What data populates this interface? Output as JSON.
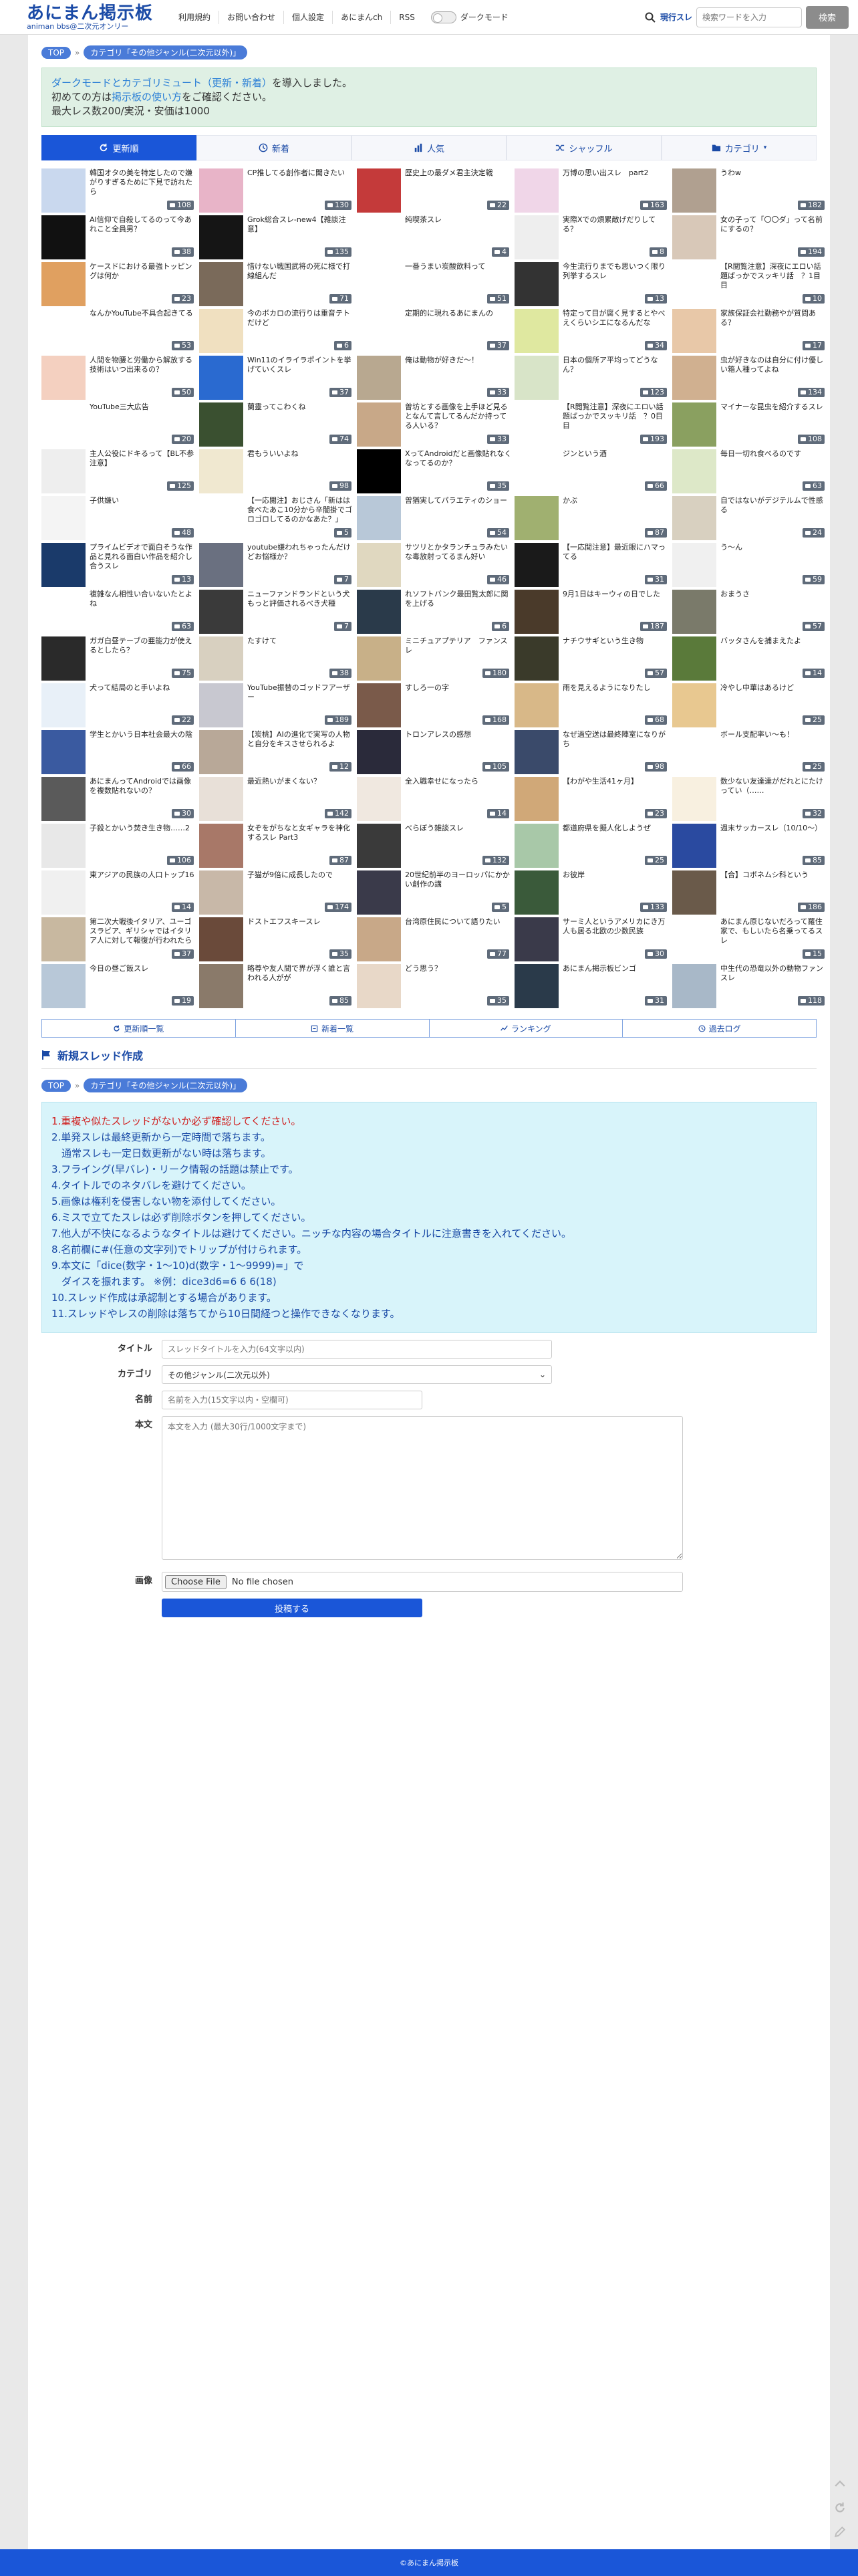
{
  "header": {
    "logo_main": "あにまん掲示板",
    "logo_sub": "animan bbs@二次元オンリー",
    "nav": [
      "利用規約",
      "お問い合わせ",
      "個人設定",
      "あにまんch",
      "RSS"
    ],
    "dark_mode_label": "ダークモード",
    "search_label": "現行スレ",
    "search_placeholder": "検索ワードを入力",
    "search_button": "検索"
  },
  "breadcrumb": {
    "top": "TOP",
    "category": "カテゴリ「その他ジャンル(二次元以外)」"
  },
  "notice": {
    "line1_link": "ダークモードとカテゴリミュート（更新・新着）",
    "line1_rest": "を導入しました。",
    "line2_pre": "初めての方は",
    "line2_link": "掲示板の使い方",
    "line2_post": "をご確認ください。",
    "line3": "最大レス数200/実況・安価は1000"
  },
  "tabs": [
    {
      "label": "更新順",
      "icon": "refresh-icon"
    },
    {
      "label": "新着",
      "icon": "clock-icon"
    },
    {
      "label": "人気",
      "icon": "bar-chart-icon"
    },
    {
      "label": "シャッフル",
      "icon": "shuffle-icon"
    },
    {
      "label": "カテゴリ",
      "icon": "folder-icon"
    }
  ],
  "threads": [
    {
      "title": "韓国オタの美を特定したので嫌がりすぎるために下見で訪れたら",
      "count": "108",
      "color": "#c9d8ee"
    },
    {
      "title": "CP推してる創作者に聞きたい",
      "count": "130",
      "color": "#e8b4c8"
    },
    {
      "title": "歴史上の最ダメ君主決定戦",
      "count": "22",
      "color": "#c43a3a"
    },
    {
      "title": "万博の思い出スレ　part2",
      "count": "163",
      "color": "#f0d6e8"
    },
    {
      "title": "うわw",
      "count": "182",
      "color": "#b0a090"
    },
    {
      "title": "AI信仰で自殺してるのって今あれこと全員男？",
      "count": "38",
      "color": "#111111"
    },
    {
      "title": "Grok総合スレ-new4【雑談注意】",
      "count": "135",
      "color": "#151515"
    },
    {
      "title": "純喫茶スレ",
      "count": "4",
      "color": "#ffffff"
    },
    {
      "title": "実際Xでの煩累敵げだりしてる？",
      "count": "8",
      "color": "#eeeeee"
    },
    {
      "title": "女の子って「〇〇ダ」って名前にするの？",
      "count": "194",
      "color": "#d8c8b8"
    },
    {
      "title": "ケースドにおける最強トッピングは何か",
      "count": "23",
      "color": "#e0a060"
    },
    {
      "title": "惜けない戦国武将の死に様で打線組んだ",
      "count": "71",
      "color": "#7a6a5a"
    },
    {
      "title": "一番うまい炭酸飲料って",
      "count": "51",
      "color": "#ffffff"
    },
    {
      "title": "今生流行りまでも思いつく限り列挙するスレ",
      "count": "13",
      "color": "#333333"
    },
    {
      "title": "【R閲覧注意】深夜にエロい話題ばっかでスッキリ話　？1目目",
      "count": "10",
      "color": "#ffffff"
    },
    {
      "title": "なんかYouTube不具合起きてる",
      "count": "53",
      "color": "#ffffff"
    },
    {
      "title": "今のボカロの流行りは重音テトだけど",
      "count": "6",
      "color": "#f0e0c0"
    },
    {
      "title": "定期的に現れるあにまんの",
      "count": "37",
      "color": "#ffffff"
    },
    {
      "title": "特定って目が腐く見するとやべえくらいシエになるんだな",
      "count": "34",
      "color": "#dfe8a0"
    },
    {
      "title": "家族保証会社勤務やが質問ある？",
      "count": "17",
      "color": "#e8c8a8"
    },
    {
      "title": "人間を物腰と労働から解放する技術はいつ出来るの？",
      "count": "50",
      "color": "#f4d0c0"
    },
    {
      "title": "Win11のイライラポイントを挙げていくスレ",
      "count": "37",
      "color": "#2a6ad0"
    },
    {
      "title": "俺は動物が好きだ～！",
      "count": "33",
      "color": "#b8a890"
    },
    {
      "title": "日本の個所ア平均ってどうなん？",
      "count": "123",
      "color": "#d8e4c8"
    },
    {
      "title": "虫が好きなのは自分に付け優しい箱人種ってよね",
      "count": "134",
      "color": "#d0b090"
    },
    {
      "title": "YouTube三大広告",
      "count": "20",
      "color": "#ffffff"
    },
    {
      "title": "蘭靈ってこわくね",
      "count": "74",
      "color": "#3a5030"
    },
    {
      "title": "曽坊とする画像を上手ほど見るとなんて言してるんだか持ってる人いる？",
      "count": "33",
      "color": "#c8a888"
    },
    {
      "title": "【R閲覧注意】深夜にエロい話題ばっかでスッキリ話　？0目目",
      "count": "193",
      "color": "#ffffff"
    },
    {
      "title": "マイナーな昆虫を紹介するスレ",
      "count": "108",
      "color": "#8aa060"
    },
    {
      "title": "主人公役にドキるって【BL不参注意】",
      "count": "125",
      "color": "#eeeeee"
    },
    {
      "title": "君もういいよね",
      "count": "98",
      "color": "#f0e8d0"
    },
    {
      "title": "XってAndroidだと画像貼れなくなってるのか？",
      "count": "35",
      "color": "#000000"
    },
    {
      "title": "ジンという酒",
      "count": "66",
      "color": "#ffffff"
    },
    {
      "title": "毎日一切れ食べるのです",
      "count": "63",
      "color": "#dde8c8"
    },
    {
      "title": "子供嫌い",
      "count": "48",
      "color": "#f4f4f4"
    },
    {
      "title": "【一応閲注】おじさん「新はは食べたあこ10分から辛闇掛でゴロゴロしてるのかなあた？」",
      "count": "5",
      "color": "#ffffff"
    },
    {
      "title": "曽猶実してパラエティのショー",
      "count": "54",
      "color": "#b8c8d8"
    },
    {
      "title": "かぶ",
      "count": "87",
      "color": "#a0b070"
    },
    {
      "title": "自ではないがデジテルムで性感る",
      "count": "24",
      "color": "#d8d0c0"
    },
    {
      "title": "プライムビデオで面白そうな作品と見れる面白い作品を紹介し合うスレ",
      "count": "13",
      "color": "#1a3a6a"
    },
    {
      "title": "youtube嫌われちゃったんだけどお悩様か？",
      "count": "7",
      "color": "#6a7080"
    },
    {
      "title": "サツリとかタランチュラみたいな毒放射ってるまん好い",
      "count": "46",
      "color": "#e0d8c0"
    },
    {
      "title": "【一応閲注意】最近眼にハマってる",
      "count": "31",
      "color": "#1a1a1a"
    },
    {
      "title": "う～ん",
      "count": "59",
      "color": "#f0f0f0"
    },
    {
      "title": "複雑なん相性い合いないたとよね",
      "count": "63",
      "color": "#ffffff"
    },
    {
      "title": "ニューファンドランドという犬もっと評価されるべき犬種",
      "count": "7",
      "color": "#3a3a3a"
    },
    {
      "title": "れソフトバンク最田覧太郎に関を上げる",
      "count": "6",
      "color": "#2a3a4a"
    },
    {
      "title": "9月1日はキーウィの日でした",
      "count": "187",
      "color": "#4a3a2a"
    },
    {
      "title": "おまうさ",
      "count": "57",
      "color": "#7a7a6a"
    },
    {
      "title": "ガガ白昼テーブの亜能力が使えるとしたら？",
      "count": "75",
      "color": "#2a2a2a"
    },
    {
      "title": "たすけて",
      "count": "38",
      "color": "#d8d0c0"
    },
    {
      "title": "ミニチュアプテリア　ファンスレ",
      "count": "180",
      "color": "#c8b088"
    },
    {
      "title": "ナチウサギという生き物",
      "count": "57",
      "color": "#3a3a2a"
    },
    {
      "title": "バッタさんを捕まえたよ",
      "count": "14",
      "color": "#5a7a3a"
    },
    {
      "title": "犬って結局のと手いよね",
      "count": "22",
      "color": "#e8f0f8"
    },
    {
      "title": "YouTube振替のゴッドフアーザー",
      "count": "189",
      "color": "#c8c8d0"
    },
    {
      "title": "すしろ一の字",
      "count": "168",
      "color": "#7a5a4a"
    },
    {
      "title": "雨を見えるようになりたし",
      "count": "68",
      "color": "#d8b888"
    },
    {
      "title": "冷やし中華はあるけど",
      "count": "25",
      "color": "#e8c890"
    },
    {
      "title": "学生とかいう日本社会最大の陰",
      "count": "66",
      "color": "#3a5aa0"
    },
    {
      "title": "【炭桃】AIの進化で実写の人物と自分をキスさせられるよ",
      "count": "12",
      "color": "#b8a898"
    },
    {
      "title": "トロンアレスの感想",
      "count": "105",
      "color": "#2a2a3a"
    },
    {
      "title": "なぜ過空送は最終陣室になりがち",
      "count": "98",
      "color": "#3a4a6a"
    },
    {
      "title": "ボール支配率い～も！",
      "count": "25",
      "color": "#ffffff"
    },
    {
      "title": "あにまんってAndroidでは画像を複数貼れないの？",
      "count": "30",
      "color": "#5a5a5a"
    },
    {
      "title": "最近熱いがまくない？",
      "count": "142",
      "color": "#e8e0d8"
    },
    {
      "title": "全入職幸せになったら",
      "count": "14",
      "color": "#f0e8e0"
    },
    {
      "title": "【わがや生活41ヶ月】",
      "count": "23",
      "color": "#d0a878"
    },
    {
      "title": "数少ない友達達がだれとにたけってい（……",
      "count": "32",
      "color": "#f8f0e0"
    },
    {
      "title": "子殺とかいう焚き生き物……2",
      "count": "106",
      "color": "#e8e8e8"
    },
    {
      "title": "女ぞをがちなと女ギャラを神化するスレ Part3",
      "count": "87",
      "color": "#a87868"
    },
    {
      "title": "べらぼう雑談スレ",
      "count": "132",
      "color": "#3a3a3a"
    },
    {
      "title": "都道府県を擬人化しようぜ",
      "count": "25",
      "color": "#a8c8a8"
    },
    {
      "title": "週末サッカースレ（10/10～）",
      "count": "85",
      "color": "#2a4aa0"
    },
    {
      "title": "東アジアの民族の人口トップ16",
      "count": "14",
      "color": "#f0f0f0"
    },
    {
      "title": "子猫が9倍に成長したので",
      "count": "174",
      "color": "#c8b8a8"
    },
    {
      "title": "20世紀前半のヨーロッパにかかい創作の講",
      "count": "5",
      "color": "#3a3a4a"
    },
    {
      "title": "お彼岸",
      "count": "133",
      "color": "#3a5a3a"
    },
    {
      "title": "【合】コボネムシ科という",
      "count": "186",
      "color": "#6a5a4a"
    },
    {
      "title": "第二次大戦後イタリア、ユーゴスラビア、ギリシャではイタリア人に対して報復が行われたらしいけど",
      "count": "37",
      "color": "#c8b8a0"
    },
    {
      "title": "ドストエフスキースレ",
      "count": "35",
      "color": "#6a4a3a"
    },
    {
      "title": "台湾原住民について語りたい",
      "count": "77",
      "color": "#c8a888"
    },
    {
      "title": "サーミ人というアメリカにき万人も居る北欧の少数民族",
      "count": "30",
      "color": "#3a3a4a"
    },
    {
      "title": "あにまん原じないだろって羅住家で、もしいたら名乗ってるスレ",
      "count": "15",
      "color": "#ffffff"
    },
    {
      "title": "今日の昼ご飯スレ",
      "count": "19",
      "color": "#b8c8d8"
    },
    {
      "title": "略尊や友人間で界が浮く誰と言われる人がが",
      "count": "85",
      "color": "#8a7a6a"
    },
    {
      "title": "どう思う？",
      "count": "35",
      "color": "#e8d8c8"
    },
    {
      "title": "あにまん掲示板ビンゴ",
      "count": "31",
      "color": "#2a3a4a"
    },
    {
      "title": "中生代の恐竜以外の動物ファンスレ",
      "count": "118",
      "color": "#a8b8c8"
    }
  ],
  "bottom_nav": [
    {
      "label": "更新順一覧",
      "icon": "refresh-icon"
    },
    {
      "label": "新着一覧",
      "icon": "clock-icon"
    },
    {
      "label": "ランキング",
      "icon": "ranking-icon"
    },
    {
      "label": "過去ログ",
      "icon": "history-icon"
    }
  ],
  "new_thread": {
    "heading": "新規スレッド作成",
    "rules": [
      {
        "text": "1.重複や似たスレッドがないか必ず確認してください。",
        "color": "red"
      },
      {
        "text": "2.単発スレは最終更新から一定時間で落ちます。",
        "color": "blue"
      },
      {
        "text": "　通常スレも一定日数更新がない時は落ちます。",
        "color": "blue"
      },
      {
        "text": "3.フライング(早バレ)・リーク情報の話題は禁止です。",
        "color": "blue"
      },
      {
        "text": "4.タイトルでのネタバレを避けてください。",
        "color": "blue"
      },
      {
        "text": "5.画像は権利を侵害しない物を添付してください。",
        "color": "blue"
      },
      {
        "text": "6.ミスで立てたスレは必ず削除ボタンを押してください。",
        "color": "blue"
      },
      {
        "text": "7.他人が不快になるようなタイトルは避けてください。ニッチな内容の場合タイトルに注意書きを入れてください。",
        "color": "blue"
      },
      {
        "text": "8.名前欄に#(任意の文字列)でトリップが付けられます。",
        "color": "blue"
      },
      {
        "text": "9.本文に「dice(数字・1〜10)d(数字・1〜9999)=」で",
        "color": "blue"
      },
      {
        "text": "　ダイスを振れます。 ※例：dice3d6=6 6 6(18)",
        "color": "blue"
      },
      {
        "text": "10.スレッド作成は承認制とする場合があります。",
        "color": "blue"
      },
      {
        "text": "11.スレッドやレスの削除は落ちてから10日間経つと操作できなくなります。",
        "color": "blue"
      }
    ],
    "title_label": "タイトル",
    "title_placeholder": "スレッドタイトルを入力(64文字以内)",
    "category_label": "カテゴリ",
    "category_value": "その他ジャンル(二次元以外)",
    "name_label": "名前",
    "name_placeholder": "名前を入力(15文字以内・空欄可)",
    "body_label": "本文",
    "body_placeholder": "本文を入力 (最大30行/1000文字まで)",
    "image_label": "画像",
    "file_button": "Choose File",
    "file_status": "No file chosen",
    "submit": "投稿する"
  },
  "footer": "©あにまん掲示板",
  "colors": {
    "brand": "#1a4aa6",
    "active_tab": "#1a56d8",
    "notice_bg": "#dff0e4",
    "rules_bg": "#d8f4fa"
  }
}
